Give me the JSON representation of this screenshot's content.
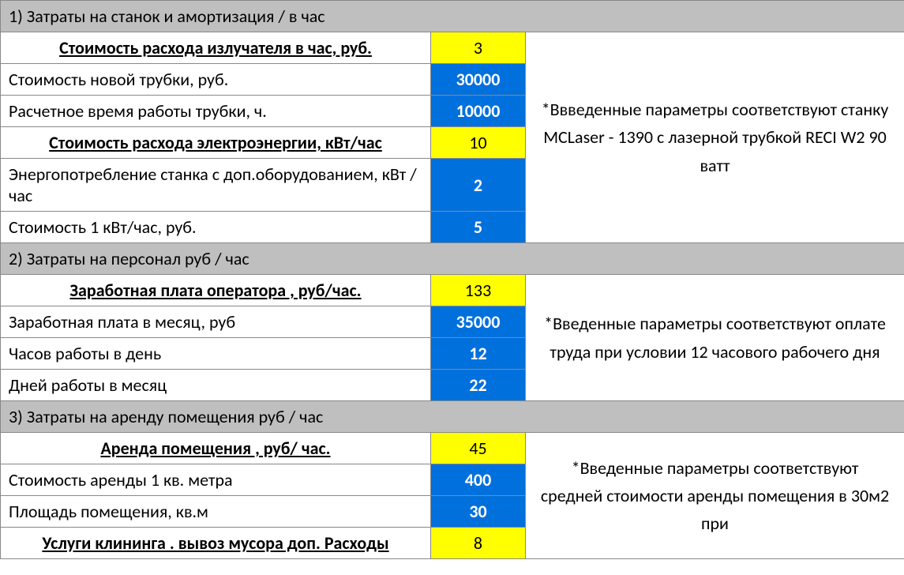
{
  "sections": {
    "s1": {
      "header": "1)  Затраты на станок и амортизация / в час",
      "emitter_cost_label": "Стоимость расхода излучателя в час, руб.",
      "emitter_cost_value": "3",
      "tube_cost_label": "Стоимость новой трубки, руб.",
      "tube_cost_value": "30000",
      "tube_time_label": "Расчетное время  работы трубки, ч.",
      "tube_time_value": "10000",
      "energy_cost_label": "Стоимость расхода электроэнергии, кВт/час",
      "energy_cost_value": "10",
      "power_usage_label": "Энергопотребление станка с доп.оборудованием, кВт / час",
      "power_usage_value": "2",
      "kwh_cost_label": "Стоимость 1 кВт/час, руб.",
      "kwh_cost_value": "5",
      "note": "*Ввведенные параметры соответствуют станку MCLaser - 1390 с лазерной трубкой RECI W2 90 ватт"
    },
    "s2": {
      "header": "2) Затраты на персонал руб / час",
      "salary_hour_label": "Заработная плата оператора , руб/час.",
      "salary_hour_value": "133",
      "salary_month_label": "Заработная плата в месяц, руб",
      "salary_month_value": "35000",
      "hours_day_label": "Часов работы в день",
      "hours_day_value": "12",
      "days_month_label": "Дней работы в месяц",
      "days_month_value": "22",
      "note": "*Введенные параметры соответствуют оплате труда при условии 12 часового рабочего дня"
    },
    "s3": {
      "header": "3) Затраты на аренду помещения руб / час",
      "rent_hour_label": "Аренда помещения , руб/ час.",
      "rent_hour_value": "45",
      "sqm_cost_label": "Стоимость аренды 1 кв. метра",
      "sqm_cost_value": "400",
      "area_label": "Площадь помещения, кв.м",
      "area_value": "30",
      "cleaning_label": "Услуги клининга . вывоз мусора доп. Расходы",
      "cleaning_value": "8",
      "note": "*Введенные параметры соответствуют средней стоимости аренды помещения в 30м2 при"
    }
  }
}
